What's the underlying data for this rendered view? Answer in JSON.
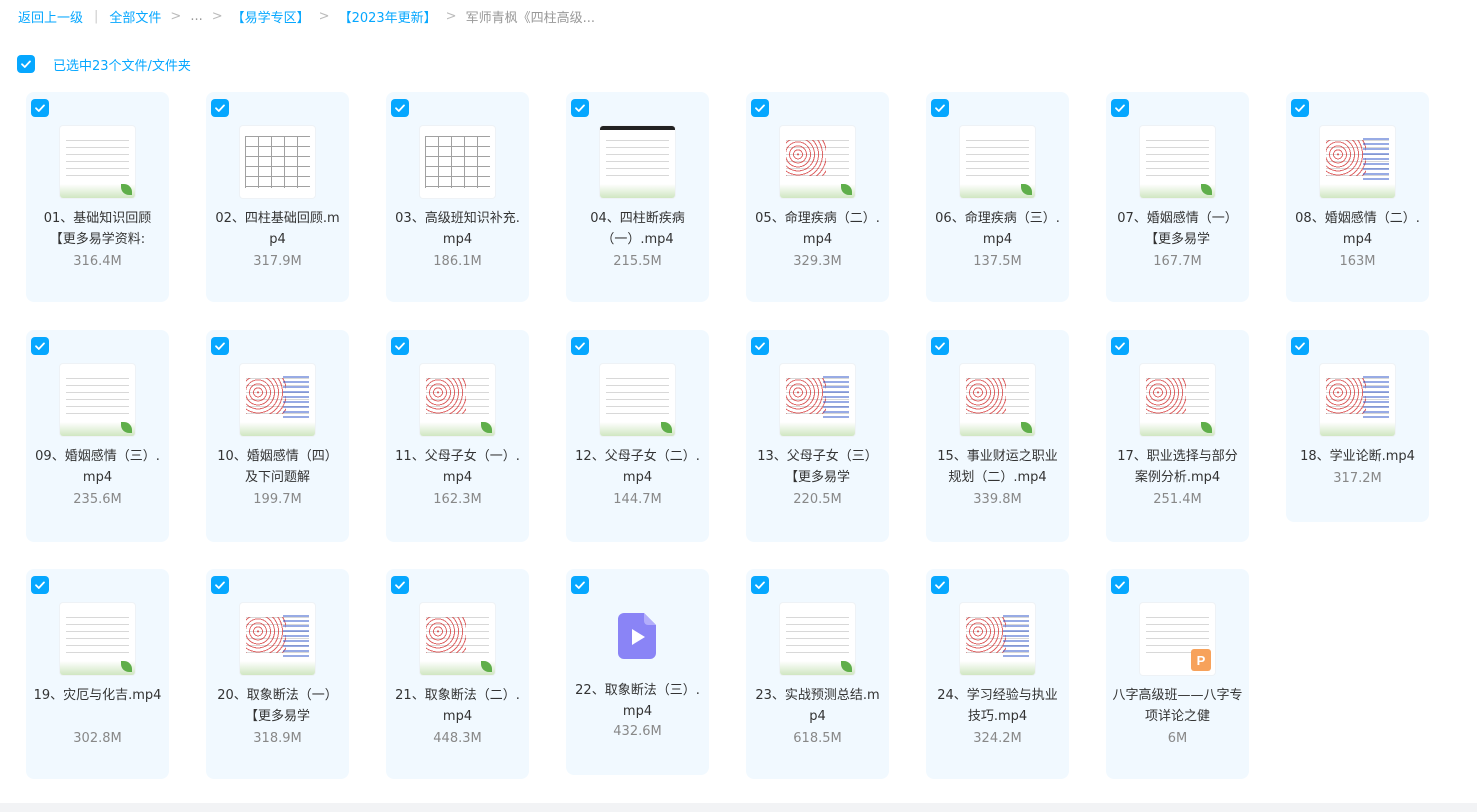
{
  "breadcrumb": {
    "back": "返回上一级",
    "all_files": "全部文件",
    "ellipsis": "...",
    "level1": "【易学专区】",
    "level2": "【2023年更新】",
    "current": "军师青枫《四柱高级..."
  },
  "selection": {
    "label": "已选中23个文件/文件夹",
    "checked": true
  },
  "colors": {
    "accent": "#06a7ff",
    "card_bg": "#f1f9ff",
    "video_icon": "#8a84f6"
  },
  "files": [
    {
      "name": "01、基础知识回顾【更多易学资料:",
      "size": "316.4M",
      "thumb": "doc"
    },
    {
      "name": "02、四柱基础回顾.mp4",
      "size": "317.9M",
      "thumb": "table"
    },
    {
      "name": "03、高级班知识补充.mp4",
      "size": "186.1M",
      "thumb": "table"
    },
    {
      "name": "04、四柱断疾病（一）.mp4",
      "size": "215.5M",
      "thumb": "doc-dark"
    },
    {
      "name": "05、命理疾病（二）.mp4",
      "size": "329.3M",
      "thumb": "marked"
    },
    {
      "name": "06、命理疾病（三）.mp4",
      "size": "137.5M",
      "thumb": "doc"
    },
    {
      "name": "07、婚姻感情（一）【更多易学",
      "size": "167.7M",
      "thumb": "doc"
    },
    {
      "name": "08、婚姻感情（二）.mp4",
      "size": "163M",
      "thumb": "marked-blue"
    },
    {
      "name": "09、婚姻感情（三）.mp4",
      "size": "235.6M",
      "thumb": "doc"
    },
    {
      "name": "10、婚姻感情（四）及下问题解",
      "size": "199.7M",
      "thumb": "marked-blue"
    },
    {
      "name": "11、父母子女（一）.mp4",
      "size": "162.3M",
      "thumb": "marked"
    },
    {
      "name": "12、父母子女（二）.mp4",
      "size": "144.7M",
      "thumb": "doc"
    },
    {
      "name": "13、父母子女（三）【更多易学",
      "size": "220.5M",
      "thumb": "marked-blue"
    },
    {
      "name": "15、事业财运之职业规划（二）.mp4",
      "size": "339.8M",
      "thumb": "marked"
    },
    {
      "name": "17、职业选择与部分案例分析.mp4",
      "size": "251.4M",
      "thumb": "marked"
    },
    {
      "name": "18、学业论断.mp4",
      "size": "317.2M",
      "thumb": "marked-blue"
    },
    {
      "name": "19、灾厄与化吉.mp4",
      "size": "302.8M",
      "thumb": "doc"
    },
    {
      "name": "20、取象断法（一）【更多易学",
      "size": "318.9M",
      "thumb": "marked-blue"
    },
    {
      "name": "21、取象断法（二）.mp4",
      "size": "448.3M",
      "thumb": "marked"
    },
    {
      "name": "22、取象断法（三）.mp4",
      "size": "432.6M",
      "thumb": "video"
    },
    {
      "name": "23、实战预测总结.mp4",
      "size": "618.5M",
      "thumb": "doc"
    },
    {
      "name": "24、学习经验与执业技巧.mp4",
      "size": "324.2M",
      "thumb": "marked-blue"
    },
    {
      "name": "八字高级班——八字专项详论之健",
      "size": "6M",
      "thumb": "ppt"
    }
  ]
}
